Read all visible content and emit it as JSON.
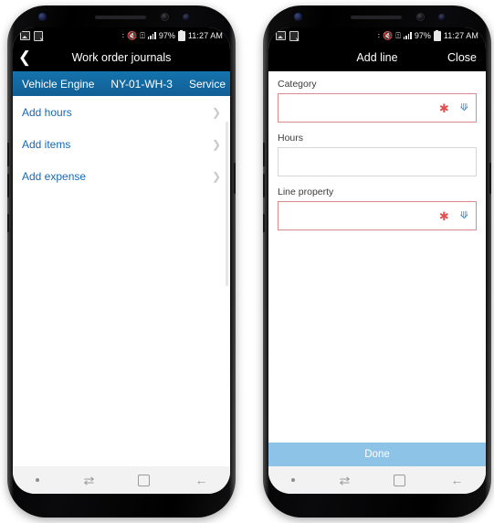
{
  "phones": [
    {
      "id": "left",
      "status_bar": {
        "notification_icons": [
          "image-icon",
          "screenshot-failed-icon"
        ],
        "bluetooth_icon": "bluetooth-icon",
        "mute_icon": "volume-muted-icon",
        "wifi_icon": "wifi-icon",
        "signal_icon": "signal-bars-icon",
        "battery_percent": "97%",
        "battery_icon": "battery-icon",
        "time": "11:27 AM"
      },
      "appbar": {
        "back_icon": "back-chevron-icon",
        "title": "Work order journals",
        "action_label": ""
      },
      "banner": {
        "col1": "Vehicle Engine",
        "col2": "NY-01-WH-3",
        "col3": "Service"
      },
      "list": [
        {
          "label": "Add hours",
          "chevron": "chevron-right-icon"
        },
        {
          "label": "Add items",
          "chevron": "chevron-right-icon"
        },
        {
          "label": "Add expense",
          "chevron": "chevron-right-icon"
        }
      ],
      "navbar": {
        "dot": "recent-dot-icon",
        "recents": "⇄",
        "home": "home-square-icon",
        "back": "←"
      }
    },
    {
      "id": "right",
      "status_bar": {
        "notification_icons": [
          "image-icon",
          "screenshot-failed-icon"
        ],
        "bluetooth_icon": "bluetooth-icon",
        "mute_icon": "volume-muted-icon",
        "wifi_icon": "wifi-icon",
        "signal_icon": "signal-bars-icon",
        "battery_percent": "97%",
        "battery_icon": "battery-icon",
        "time": "11:27 AM"
      },
      "appbar": {
        "title": "Add line",
        "action_label": "Close"
      },
      "form": {
        "fields": [
          {
            "label": "Category",
            "value": "",
            "required": true,
            "required_marker": "✱",
            "dropdown": true,
            "dropdown_icon": "chevron-down-icon"
          },
          {
            "label": "Hours",
            "value": "",
            "required": false,
            "required_marker": "",
            "dropdown": false,
            "dropdown_icon": ""
          },
          {
            "label": "Line property",
            "value": "",
            "required": true,
            "required_marker": "✱",
            "dropdown": true,
            "dropdown_icon": "chevron-down-icon"
          }
        ],
        "submit_label": "Done"
      },
      "navbar": {
        "dot": "recent-dot-icon",
        "recents": "⇄",
        "home": "home-square-icon",
        "back": "←"
      }
    }
  ],
  "colors": {
    "banner_blue": "#11689e",
    "link_blue": "#1668b8",
    "required_red": "#d98b8b",
    "asterisk_red": "#e05252",
    "dropdown_chevron_blue": "#2b87d9",
    "done_button_blue": "#8ec3e8",
    "appbar_black": "#000000",
    "navbar_gray": "#f2f2f2"
  }
}
